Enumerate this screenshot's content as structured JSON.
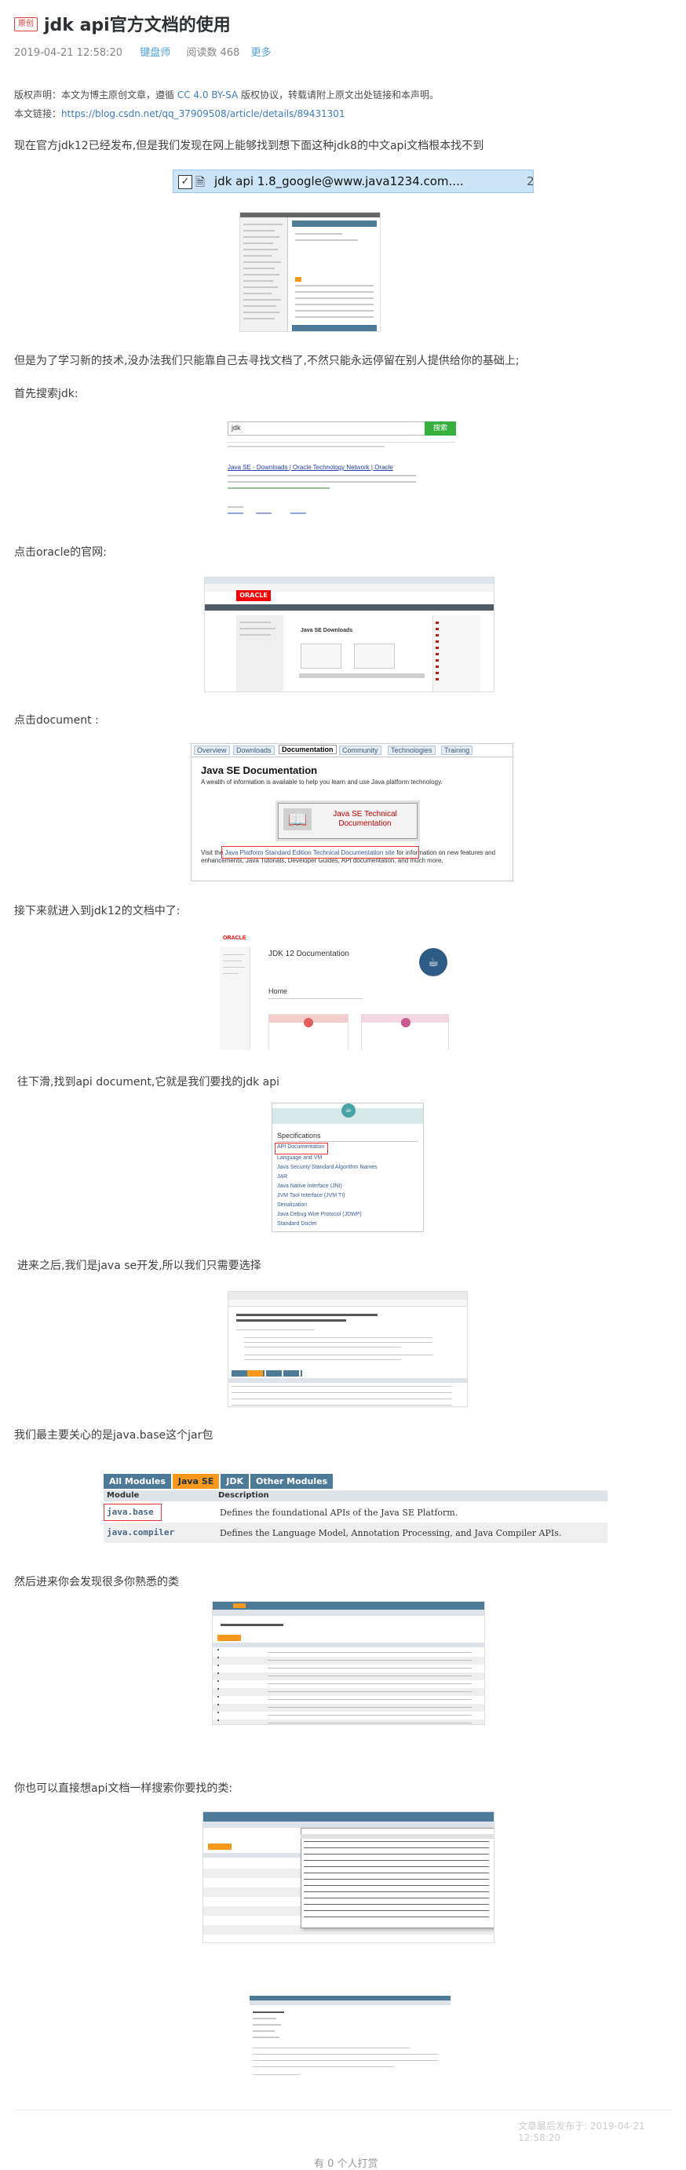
{
  "article": {
    "badge": "原创",
    "title": "jdk api官方文档的使用",
    "date": "2019-04-21 12:58:20",
    "author": "键盘师",
    "read_count": "阅读数 468",
    "more": "更多"
  },
  "copyright": {
    "line1_prefix": "版权声明：本文为博主原创文章，遵循 ",
    "license": "CC 4.0 BY-SA",
    "line1_suffix": " 版权协议，转载请附上原文出处链接和本声明。",
    "line2_label": "本文链接：",
    "url": "https://blog.csdn.net/qq_37909508/article/details/89431301"
  },
  "paragraphs": {
    "p1": "现在官方jdk12已经发布,但是我们发现在网上能够找到想下面这种jdk8的中文api文档根本找不到",
    "p2": "但是为了学习新的技术,没办法我们只能靠自己去寻找文档了,不然只能永远停留在别人提供给你的基础上;",
    "p3": "首先搜索jdk:",
    "p4": "点击oracle的官网:",
    "p5": "点击document :",
    "p6": "接下来就进入到jdk12的文档中了:",
    "p7": "往下滑,找到api document,它就是我们要找的jdk api",
    "p8": "进来之后,我们是java se开发,所以我们只需要选择",
    "p9": "我们最主要关心的是java.base这个jar包",
    "p10": "然后进来你会发现很多你熟悉的类",
    "p11": "你也可以直接想api文档一样搜索你要找的类:"
  },
  "file_bar": {
    "filename": "jdk api 1.8_google@www.java1234.com....",
    "count": "2"
  },
  "search_shot": {
    "query": "jdk",
    "button": "搜索",
    "result_title": "Java SE - Downloads | Oracle Technology Network | Oracle"
  },
  "oracle_shot": {
    "logo": "ORACLE",
    "heading": "Java SE Downloads"
  },
  "doc_shot": {
    "tabs": [
      "Overview",
      "Downloads",
      "Documentation",
      "Community",
      "Technologies",
      "Training"
    ],
    "heading": "Java SE Documentation",
    "subheading": "A wealth of information is available to help you learn and use Java platform technology.",
    "button": "Java SE Technical Documentation",
    "visit_prefix": "Visit the ",
    "visit_link": "Java Platform Standard Edition Technical Documentation site",
    "visit_suffix": " for information on new features and enhancements, Java Tutorials, Developer Guides, API documentation, and much more."
  },
  "jdk12_shot": {
    "logo": "ORACLE",
    "heading": "JDK 12 Documentation",
    "home": "Home"
  },
  "spec_shot": {
    "heading": "Specifications",
    "items": [
      "API Documentation",
      "Language and VM",
      "Java Security Standard Algorithm Names",
      "JAR",
      "Java Native Interface (JNI)",
      "JVM Tool Interface (JVM TI)",
      "Serialization",
      "Java Debug Wire Protocol (JDWP)",
      "Standard Doclet"
    ]
  },
  "modules": {
    "tabs": [
      "All Modules",
      "Java SE",
      "JDK",
      "Other Modules"
    ],
    "active_tab": "Java SE",
    "headers": [
      "Module",
      "Description"
    ],
    "rows": [
      {
        "module": "java.base",
        "description": "Defines the foundational APIs of the Java SE Platform."
      },
      {
        "module": "java.compiler",
        "description": "Defines the Language Model, Annotation Processing, and Java Compiler APIs."
      }
    ]
  },
  "footer": {
    "published": "文章最后发布于: 2019-04-21 12:58:20",
    "tip": "有 0 个人打赏"
  }
}
